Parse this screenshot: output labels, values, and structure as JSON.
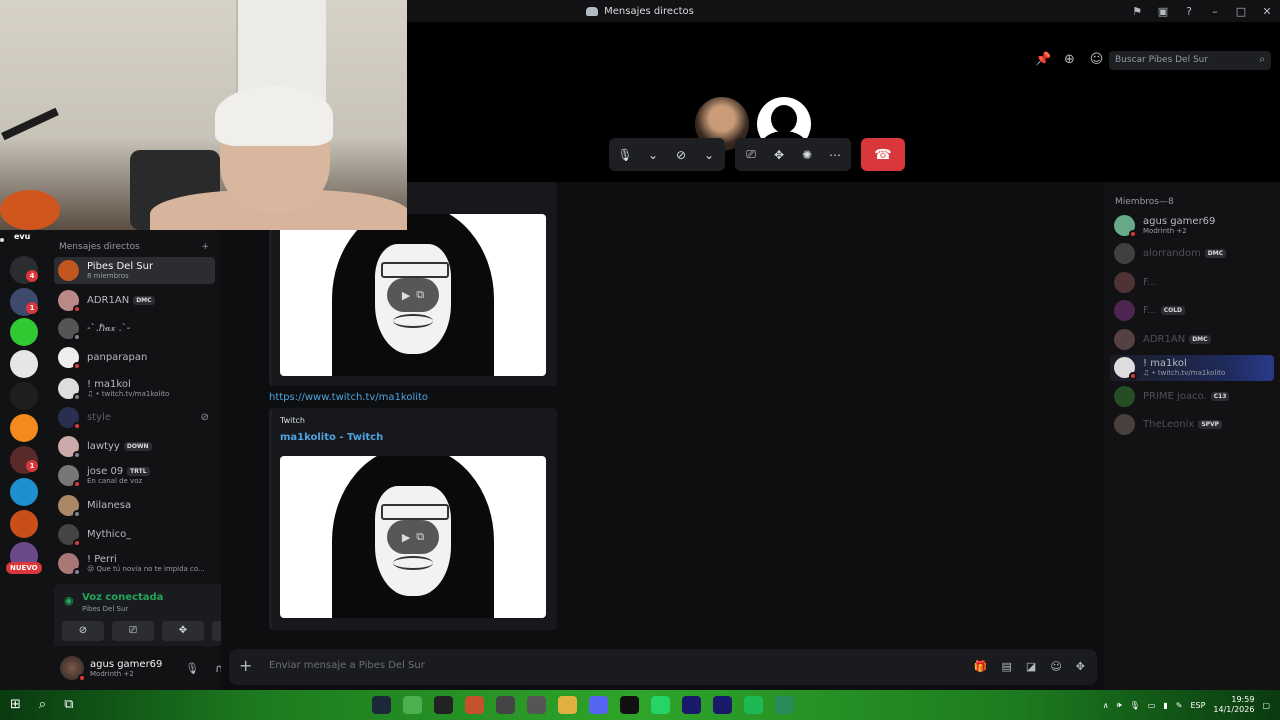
{
  "window": {
    "title": "Mensajes directos",
    "controls": [
      "inbox-icon",
      "monitor-icon",
      "help-icon",
      "minimize",
      "maximize",
      "close"
    ]
  },
  "header": {
    "search_placeholder": "Buscar Pibes Del Sur",
    "icons": [
      "pin-icon",
      "add-member-icon",
      "members-icon"
    ]
  },
  "call": {
    "controls": [
      "microphone",
      "camera-off",
      "share-screen",
      "activities",
      "soundboard",
      "more",
      "hang-up"
    ]
  },
  "servers": {
    "top_label": "evu",
    "badges": [
      "4",
      "1",
      "1"
    ],
    "new_label": "NUEVO"
  },
  "dm_list": {
    "header": "Mensajes directos",
    "add_symbol": "+",
    "items": [
      {
        "name": "Pibes Del Sur",
        "sub": "8 miembros",
        "selected": true,
        "avatar_color": "#c2561f"
      },
      {
        "name": "ADR1AN",
        "tag": "DMC",
        "sub": "",
        "avatar_color": "#b88"
      },
      {
        "name": "-`.ℏ𝒶𝓍 .`-",
        "sub": "",
        "avatar_color": "#555"
      },
      {
        "name": "panparapan",
        "sub": "",
        "avatar_color": "#eee"
      },
      {
        "name": "! ma1kol",
        "sub": "♫ • twitch.tv/ma1kolito",
        "avatar_color": "#ddd"
      },
      {
        "name": "style",
        "sub": "",
        "dim": true,
        "avatar_color": "#2a2f50"
      },
      {
        "name": "lawtyy",
        "tag": "DOWN",
        "sub": "",
        "avatar_color": "#caa"
      },
      {
        "name": "jose 09",
        "tag": "TRTL",
        "sub": "En canal de voz",
        "avatar_color": "#777"
      },
      {
        "name": "Milanesa",
        "sub": "",
        "avatar_color": "#a86"
      },
      {
        "name": "Mythico_",
        "sub": "",
        "avatar_color": "#444"
      },
      {
        "name": "! Perri",
        "sub": "😢 Que tú novia no te impida co...",
        "avatar_color": "#a77"
      }
    ]
  },
  "voice": {
    "title": "Voz conectada",
    "channel": "Pibes Del Sur"
  },
  "user": {
    "name": "agus gamer69",
    "activity": "Modrinth +2"
  },
  "chat": {
    "link": "https://www.twitch.tv/ma1kolito",
    "embed_provider": "Twitch",
    "embed_title": "ma1kolito - Twitch",
    "composer_placeholder": "Enviar mensaje a Pibes Del Sur",
    "composer_plus": "+"
  },
  "members": {
    "header": "Miembros—8",
    "list": [
      {
        "name": "agus gamer69",
        "sub": "Modrinth +2",
        "avatar_color": "#6a8"
      },
      {
        "name": "alorrandom",
        "tag": "DMC",
        "dim": true,
        "avatar_color": "#888"
      },
      {
        "name": "F...",
        "dim": true,
        "avatar_color": "#a66"
      },
      {
        "name": "F...",
        "tag": "COLD",
        "dim": true,
        "avatar_color": "#a4a"
      },
      {
        "name": "ADR1AN",
        "tag": "DMC",
        "dim": true,
        "avatar_color": "#b88"
      },
      {
        "name": "! ma1kol",
        "sub": "♫ • twitch.tv/ma1kolito",
        "active": true,
        "avatar_color": "#ddd"
      },
      {
        "name": "PRIME joaco.",
        "tag": "C13",
        "dim": true,
        "avatar_color": "#4a4"
      },
      {
        "name": "TheLeonix",
        "tag": "SPVP",
        "dim": true,
        "avatar_color": "#987"
      }
    ]
  },
  "taskbar": {
    "language": "ESP",
    "time": "19:59",
    "date": "14/1/2026",
    "app_colors": [
      "#1b2838",
      "#4caf50",
      "#222",
      "#c4522a",
      "#444",
      "#555",
      "#e0b040",
      "#5865f2",
      "#111",
      "#25d366",
      "#1a1a6a",
      "#1a1a6a",
      "#1db954",
      "#2a8a5a"
    ]
  }
}
